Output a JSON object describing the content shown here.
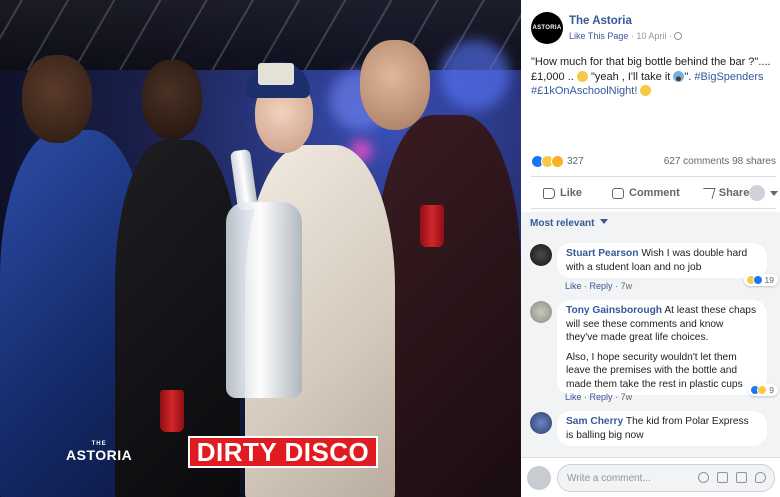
{
  "photo": {
    "brand_the": "THE",
    "brand_name": "ASTORIA",
    "event_name": "DIRTY DISCO"
  },
  "post": {
    "page_avatar_text": "ASTORIA",
    "page_name": "The Astoria",
    "like_page": "Like This Page",
    "separator": "·",
    "date": "10 April",
    "text_line1": "\"How much for that big bottle behind the bar ?\"....",
    "text_line2a": "£1,000 ..",
    "text_line2b": "\"yeah , I'll take it",
    "text_line2c": "\".",
    "hashtag1": "#BigSpenders",
    "hashtag2": "#£1kOnAschoolNight!",
    "reaction_count": "327",
    "comments_count": "627 comments",
    "shares_count": "98 shares"
  },
  "actions": {
    "like": "Like",
    "comment": "Comment",
    "share": "Share"
  },
  "filter": {
    "label": "Most relevant"
  },
  "comments": [
    {
      "author": "Stuart Pearson",
      "text": "Wish I was double hard with a student loan and no job",
      "like": "Like",
      "reply": "Reply",
      "dot": "·",
      "age": "7w",
      "reactions": "19"
    },
    {
      "author": "Tony Gainsborough",
      "text": "At least these chaps will see these comments and know they've made great life choices.",
      "text2": "Also, I hope security wouldn't let them leave the premises with the bottle and made them take the rest in plastic cups",
      "like": "Like",
      "reply": "Reply",
      "dot": "·",
      "age": "7w",
      "reactions": "9"
    },
    {
      "author": "Sam Cherry",
      "text": "The kid from Polar Express is balling big now"
    }
  ],
  "composer": {
    "placeholder": "Write a comment..."
  },
  "colors": {
    "link": "#385898",
    "like_blue": "#1877f2",
    "brand_red": "#e11b22",
    "comment_bg": "#f2f3f5"
  },
  "icons": [
    "globe-icon",
    "like-icon",
    "comment-icon",
    "share-icon",
    "emoji-icon",
    "camera-icon",
    "gif-icon",
    "sticker-icon"
  ]
}
